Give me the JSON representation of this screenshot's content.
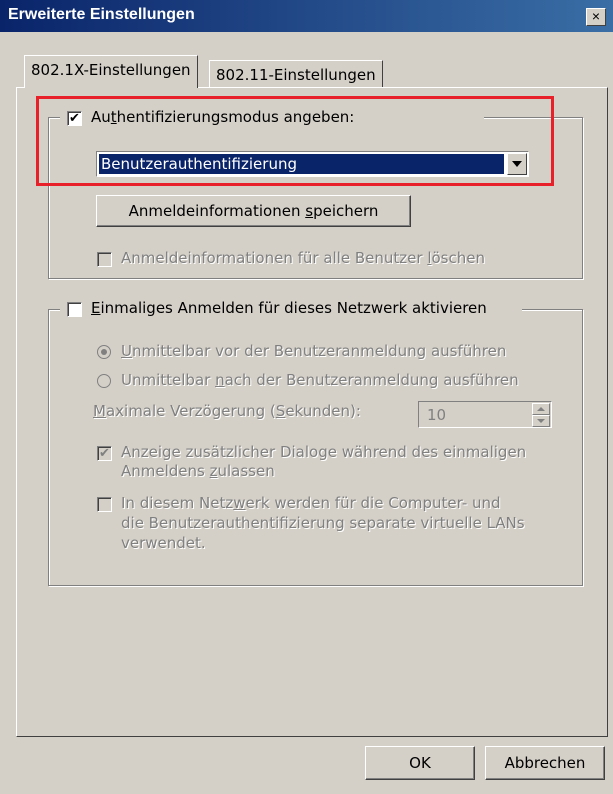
{
  "window": {
    "title": "Erweiterte Einstellungen",
    "close_glyph": "×"
  },
  "tabs": [
    {
      "label": "802.1X-Einstellungen",
      "selected": true
    },
    {
      "label": "802.11-Einstellungen",
      "selected": false
    }
  ],
  "auth_group": {
    "checkbox_label_pre": "Au",
    "checkbox_label_ul": "t",
    "checkbox_label_post": "hentifizierungsmodus angeben:",
    "checked": true,
    "check_glyph": "✔",
    "mode_value": "Benutzerauthentifizierung",
    "save_button_pre": "Anmeldeinformationen ",
    "save_button_ul": "s",
    "save_button_post": "peichern",
    "delete_all_pre": "Anmeldeinformationen für alle Benutzer ",
    "delete_all_ul": "l",
    "delete_all_post": "öschen",
    "delete_all_checked": false
  },
  "sso_group": {
    "checkbox_label_pre": "",
    "checkbox_label_ul": "E",
    "checkbox_label_post": "inmaliges Anmelden für dieses Netzwerk aktivieren",
    "checked": false,
    "radio_before_pre": "",
    "radio_before_ul": "U",
    "radio_before_post": "nmittelbar vor der Benutzeranmeldung ausführen",
    "radio_before_selected": true,
    "radio_after_pre": "Unmittelbar ",
    "radio_after_ul": "n",
    "radio_after_post": "ach der Benutzeranmeldung ausführen",
    "radio_after_selected": false,
    "max_delay_pre": "",
    "max_delay_ul": "M",
    "max_delay_mid": "aximale Verzögerung (",
    "max_delay_ul2": "S",
    "max_delay_post": "ekunden):",
    "max_delay_value": "10",
    "extra_dialogs_line1": "Anzeige zusätzlicher Dialoge während des einmaligen",
    "extra_dialogs_line2_pre": "Anmeldens ",
    "extra_dialogs_line2_ul": "z",
    "extra_dialogs_line2_post": "ulassen",
    "extra_dialogs_checked": true,
    "vlan_line1_pre": "In diesem Netz",
    "vlan_line1_ul": "w",
    "vlan_line1_post": "erk werden für die Computer- und",
    "vlan_line2": "die Benutzerauthentifizierung separate virtuelle LANs",
    "vlan_line3": "verwendet.",
    "vlan_checked": false
  },
  "buttons": {
    "ok": "OK",
    "cancel": "Abbrechen"
  },
  "colors": {
    "highlight": "#e8202a",
    "selection": "#0a246a",
    "face": "#d4d0c8"
  }
}
